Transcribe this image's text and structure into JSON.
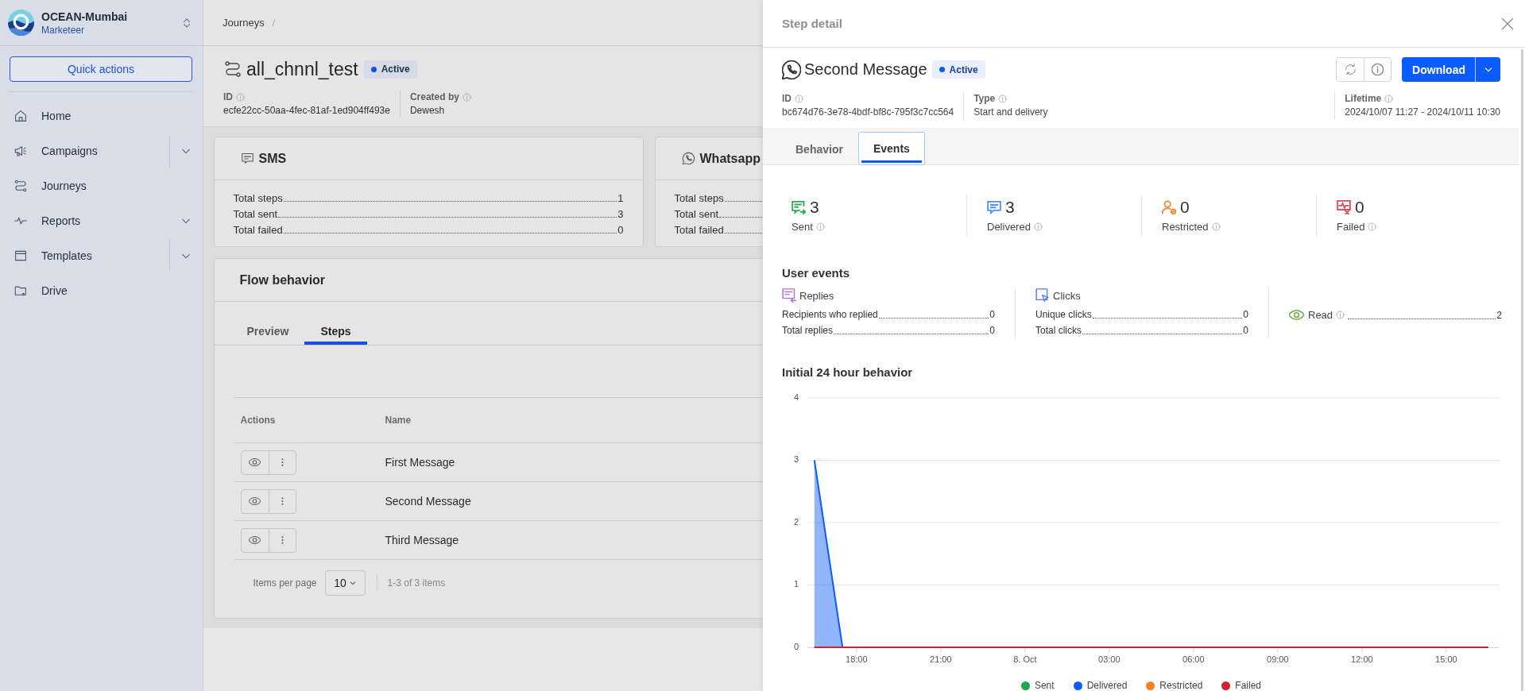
{
  "sidebar": {
    "org": "OCEAN-Mumbai",
    "role": "Marketeer",
    "quick_actions": "Quick actions",
    "items": [
      {
        "label": "Home",
        "split": false
      },
      {
        "label": "Campaigns",
        "split": true,
        "expanded": false
      },
      {
        "label": "Journeys",
        "split": false
      },
      {
        "label": "Reports",
        "split": false,
        "expanded": false
      },
      {
        "label": "Templates",
        "split": true,
        "expanded": false
      },
      {
        "label": "Drive",
        "split": false
      }
    ]
  },
  "breadcrumb": {
    "items": [
      "Journeys"
    ],
    "separator": "/"
  },
  "journey": {
    "title": "all_chnnl_test",
    "status": "Active",
    "meta": [
      {
        "label": "ID",
        "value": "ecfe22cc-50aa-4fec-81af-1ed904ff493e"
      },
      {
        "label": "Created by",
        "value": "Dewesh"
      }
    ]
  },
  "channels": [
    {
      "name": "SMS",
      "rows": [
        {
          "label": "Total steps",
          "value": "1"
        },
        {
          "label": "Total sent",
          "value": "3"
        },
        {
          "label": "Total failed",
          "value": "0"
        }
      ]
    },
    {
      "name": "Whatsapp",
      "rows": [
        {
          "label": "Total steps"
        },
        {
          "label": "Total sent"
        },
        {
          "label": "Total failed"
        }
      ]
    }
  ],
  "flow": {
    "title": "Flow behavior",
    "tabs": [
      {
        "label": "Preview",
        "selected": false
      },
      {
        "label": "Steps",
        "selected": true
      }
    ],
    "table": {
      "columns": [
        "Actions",
        "Name"
      ],
      "rows": [
        {
          "name": "First Message"
        },
        {
          "name": "Second Message"
        },
        {
          "name": "Third Message"
        }
      ]
    },
    "pagination": {
      "label": "Items per page",
      "page_size": "10",
      "range": "1-3 of 3 items"
    }
  },
  "step_detail": {
    "title": "Step detail",
    "name": "Second Message",
    "status": "Active",
    "download": "Download",
    "meta": [
      {
        "label": "ID",
        "value": "bc674d76-3e78-4bdf-bf8c-795f3c7cc564"
      },
      {
        "label": "Type",
        "value": "Start and delivery"
      },
      {
        "label": "Lifetime",
        "value": "2024/10/07 11:27 - 2024/10/11 10:30"
      }
    ],
    "tabs": [
      {
        "label": "Behavior",
        "selected": false
      },
      {
        "label": "Events",
        "selected": true
      }
    ],
    "stats": [
      {
        "value": "3",
        "label": "Sent",
        "color": "#2eaa55"
      },
      {
        "value": "3",
        "label": "Delivered",
        "color": "#4f8ff7"
      },
      {
        "value": "0",
        "label": "Restricted",
        "color": "#f08c3b"
      },
      {
        "value": "0",
        "label": "Failed",
        "color": "#e04c55"
      }
    ],
    "user_events": {
      "title": "User events",
      "groups": [
        {
          "title": "Replies",
          "color": "#b06fe0",
          "rows": [
            {
              "label": "Recipients who replied",
              "value": "0"
            },
            {
              "label": "Total replies",
              "value": "0"
            }
          ]
        },
        {
          "title": "Clicks",
          "color": "#4b80f0",
          "rows": [
            {
              "label": "Unique clicks",
              "value": "0"
            },
            {
              "label": "Total clicks",
              "value": "0"
            }
          ]
        },
        {
          "color": "#6aae4a",
          "rows": [
            {
              "label": "Read",
              "value": "2"
            }
          ]
        }
      ]
    },
    "chart": {
      "chart_data": {
        "type": "area",
        "title": "Initial 24 hour behavior",
        "x": [
          "2024-10-07T16:30",
          "2024-10-07T17:30",
          "2024-10-07T18:30",
          "2024-10-07T19:30",
          "2024-10-07T20:30",
          "2024-10-07T21:30",
          "2024-10-07T22:30",
          "2024-10-07T23:30",
          "2024-10-08T00:30",
          "2024-10-08T01:30",
          "2024-10-08T02:30",
          "2024-10-08T03:30",
          "2024-10-08T04:30",
          "2024-10-08T05:30",
          "2024-10-08T06:30",
          "2024-10-08T07:30",
          "2024-10-08T08:30",
          "2024-10-08T09:30",
          "2024-10-08T10:30",
          "2024-10-08T11:30",
          "2024-10-08T12:30",
          "2024-10-08T13:30",
          "2024-10-08T14:30",
          "2024-10-08T15:30",
          "2024-10-08T16:30"
        ],
        "series": [
          {
            "name": "Sent",
            "color": "#22a350",
            "values": [
              null,
              null,
              null,
              null,
              null,
              null,
              null,
              null,
              null,
              null,
              null,
              null,
              null,
              null,
              null,
              null,
              null,
              null,
              null,
              null,
              null,
              null,
              null,
              null,
              null
            ]
          },
          {
            "name": "Delivered",
            "color": "#0b5cff",
            "values": [
              3,
              0,
              0,
              0,
              0,
              0,
              0,
              0,
              0,
              0,
              0,
              0,
              0,
              0,
              0,
              0,
              0,
              0,
              0,
              0,
              0,
              0,
              0,
              0,
              0
            ]
          },
          {
            "name": "Restricted",
            "color": "#f0822b",
            "values": [
              null,
              null,
              null,
              null,
              null,
              null,
              null,
              null,
              null,
              null,
              null,
              null,
              null,
              null,
              null,
              null,
              null,
              null,
              null,
              null,
              null,
              null,
              null,
              null,
              null
            ]
          },
          {
            "name": "Failed",
            "color": "#d2222d",
            "values": [
              0,
              0,
              0,
              0,
              0,
              0,
              0,
              0,
              0,
              0,
              0,
              0,
              0,
              0,
              0,
              0,
              0,
              0,
              0,
              0,
              0,
              0,
              0,
              0,
              0
            ]
          }
        ],
        "xlim": [
          "2024-10-07T16:15",
          "2024-10-08T16:54"
        ],
        "ylim": [
          0,
          4
        ],
        "xticks": [
          {
            "value": "2024-10-07T18:00",
            "label": "18:00"
          },
          {
            "value": "2024-10-07T21:00",
            "label": "21:00"
          },
          {
            "value": "2024-10-08T00:00",
            "label": "8. Oct"
          },
          {
            "value": "2024-10-08T03:00",
            "label": "03:00"
          },
          {
            "value": "2024-10-08T06:00",
            "label": "06:00"
          },
          {
            "value": "2024-10-08T09:00",
            "label": "09:00"
          },
          {
            "value": "2024-10-08T12:00",
            "label": "12:00"
          },
          {
            "value": "2024-10-08T15:00",
            "label": "15:00"
          }
        ],
        "yticks": [
          0,
          1,
          2,
          3,
          4
        ],
        "grid": true
      }
    }
  }
}
